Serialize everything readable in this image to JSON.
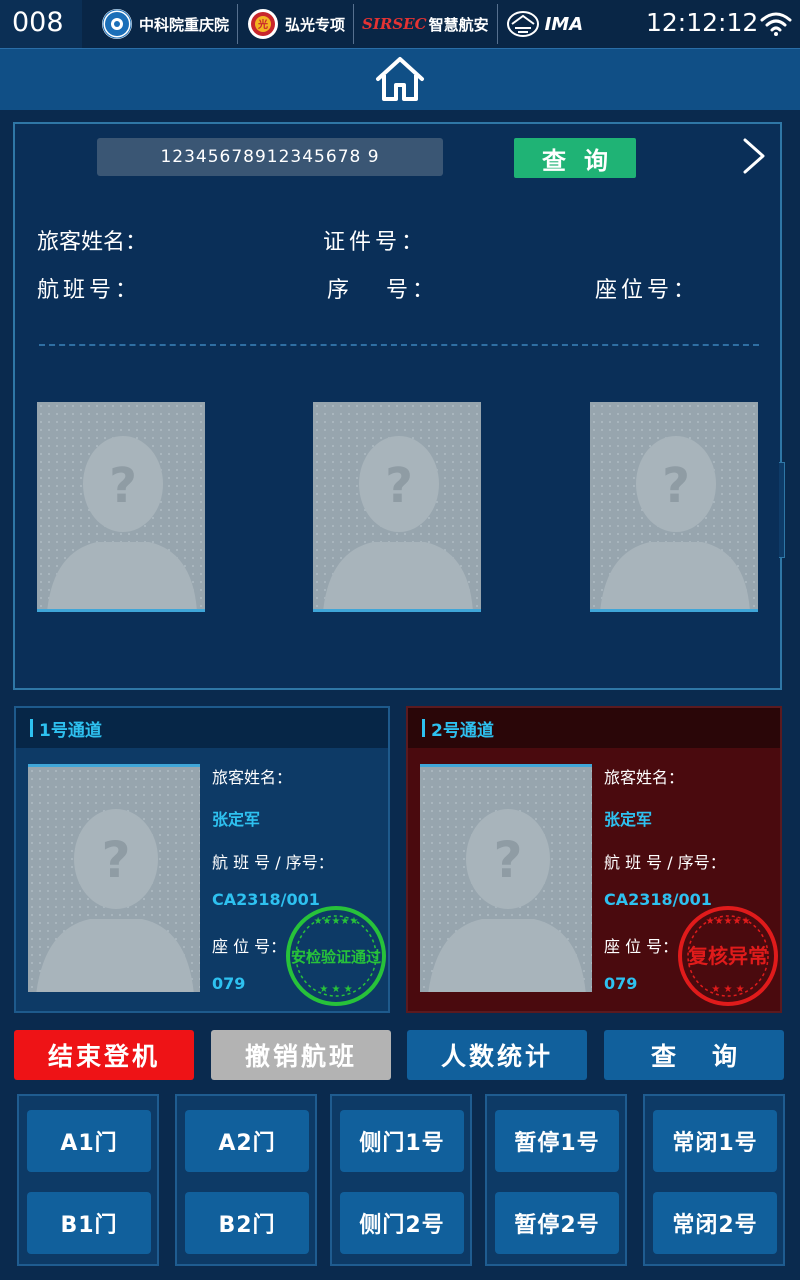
{
  "status_bar": {
    "device_id": "008",
    "logos": [
      {
        "name": "cas-logo",
        "text": "中科院重庆院"
      },
      {
        "name": "hongguang-logo",
        "text": "弘光专项"
      },
      {
        "name": "sirsec-logo",
        "text": "智慧航安",
        "mark": "SIRSEC"
      },
      {
        "name": "ima-logo",
        "text": "IMA"
      }
    ],
    "time": "12:12:12"
  },
  "query": {
    "input_value": "12345678912345678 9",
    "search_label": "查询",
    "fields": {
      "name_label": "旅客姓名：",
      "id_label": "证件号：",
      "flight_label": "航班号：",
      "seq_label": "序   号：",
      "seat_label": "座位号："
    }
  },
  "channels": [
    {
      "title": "1号通道",
      "name_label": "旅客姓名：",
      "name": "张定军",
      "flight_label": "航 班 号 / 序号：",
      "flight": "CA2318/001",
      "seat_label": "座 位 号：",
      "seat": "079",
      "stamp_text": "安检验证通过",
      "stamp_color": "#27c23a"
    },
    {
      "title": "2号通道",
      "name_label": "旅客姓名：",
      "name": "张定军",
      "flight_label": "航 班 号 / 序号：",
      "flight": "CA2318/001",
      "seat_label": "座 位 号：",
      "seat": "079",
      "stamp_text": "复核异常",
      "stamp_color": "#e01b1b"
    }
  ],
  "actions": {
    "end_boarding": "结束登机",
    "cancel_flight": "撤销航班",
    "headcount": "人数统计",
    "query": "查询"
  },
  "gates": [
    {
      "top": "A1门",
      "bottom": "B1门"
    },
    {
      "top": "A2门",
      "bottom": "B2门"
    },
    {
      "top": "侧门1号",
      "bottom": "侧门2号"
    },
    {
      "top": "暂停1号",
      "bottom": "暂停2号"
    },
    {
      "top": "常闭1号",
      "bottom": "常闭2号"
    }
  ],
  "colors": {
    "accent_green": "#1fb375",
    "danger_red": "#ee1316",
    "channel_text": "#2ec1f0"
  }
}
